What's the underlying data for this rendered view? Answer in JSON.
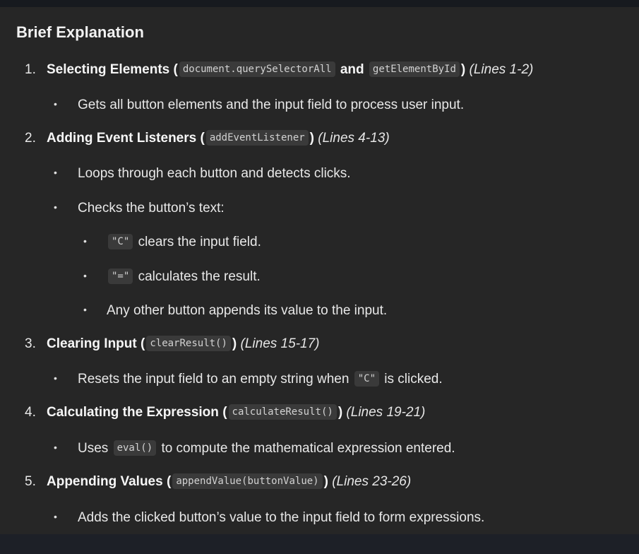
{
  "heading": "Brief Explanation",
  "items": [
    {
      "number": "1.",
      "title": "Selecting Elements",
      "open": "(",
      "code1": "document.querySelectorAll",
      "and": "and",
      "code2": "getElementById",
      "close": ")",
      "lines": "(Lines 1-2)",
      "bullets": [
        "Gets all button elements and the input field to process user input."
      ]
    },
    {
      "number": "2.",
      "title": "Adding Event Listeners",
      "open": "(",
      "code": "addEventListener",
      "close": ")",
      "lines": "(Lines 4-13)",
      "bullets": [
        "Loops through each button and detects clicks.",
        "Checks the button’s text:"
      ],
      "subbullets": [
        {
          "code": "\"C\"",
          "text": "clears the input field."
        },
        {
          "code": "\"=\"",
          "text": "calculates the result."
        },
        {
          "text": "Any other button appends its value to the input."
        }
      ]
    },
    {
      "number": "3.",
      "title": "Clearing Input",
      "open": "(",
      "code": "clearResult()",
      "close": ")",
      "lines": "(Lines 15-17)",
      "bullet": {
        "before": "Resets the input field to an empty string when",
        "code": "\"C\"",
        "after": "is clicked."
      }
    },
    {
      "number": "4.",
      "title": "Calculating the Expression",
      "open": "(",
      "code": "calculateResult()",
      "close": ")",
      "lines": "(Lines 19-21)",
      "bullet": {
        "before": "Uses",
        "code": "eval()",
        "after": "to compute the mathematical expression entered."
      }
    },
    {
      "number": "5.",
      "title": "Appending Values",
      "open": "(",
      "code": "appendValue(buttonValue)",
      "close": ")",
      "lines": "(Lines 23-26)",
      "bullets": [
        "Adds the clicked button’s value to the input field to form expressions."
      ]
    }
  ],
  "bullet_glyph": "•",
  "colors": {
    "background": "#262626",
    "code_background": "#3a3a3a",
    "text": "#ececec"
  }
}
